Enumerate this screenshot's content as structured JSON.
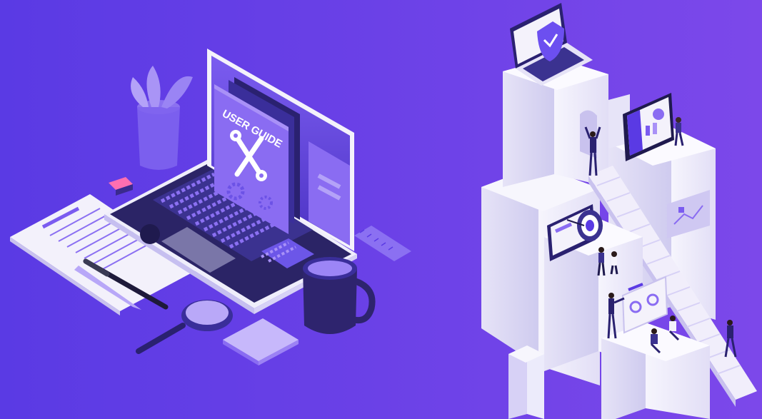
{
  "book": {
    "title": "USER GUIDE"
  },
  "colors": {
    "bg_left": "#5b3be6",
    "bg_right": "#7b4be8",
    "accent": "#8a6cf2",
    "deep": "#2a2170",
    "white": "#f4f2fb"
  }
}
